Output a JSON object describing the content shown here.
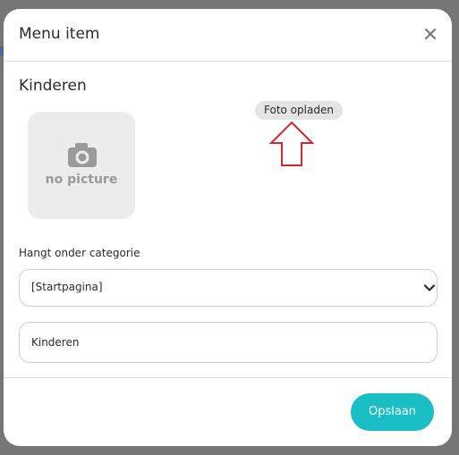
{
  "modal": {
    "title": "Menu item",
    "section_title": "Kinderen",
    "placeholder_label": "no picture",
    "upload_label": "Foto opladen",
    "category_field_label": "Hangt onder categorie",
    "category_selected": "[Startpagina]",
    "name_value": "Kinderen",
    "save_label": "Opslaan"
  },
  "icons": {
    "close": "close-icon",
    "camera": "camera-icon",
    "select_chevron": "chevron-down-icon",
    "annotation": "arrow-up-icon"
  },
  "colors": {
    "accent": "#19bfc4",
    "annotation_arrow": "#d9262c",
    "placeholder_bg": "#ececec"
  }
}
